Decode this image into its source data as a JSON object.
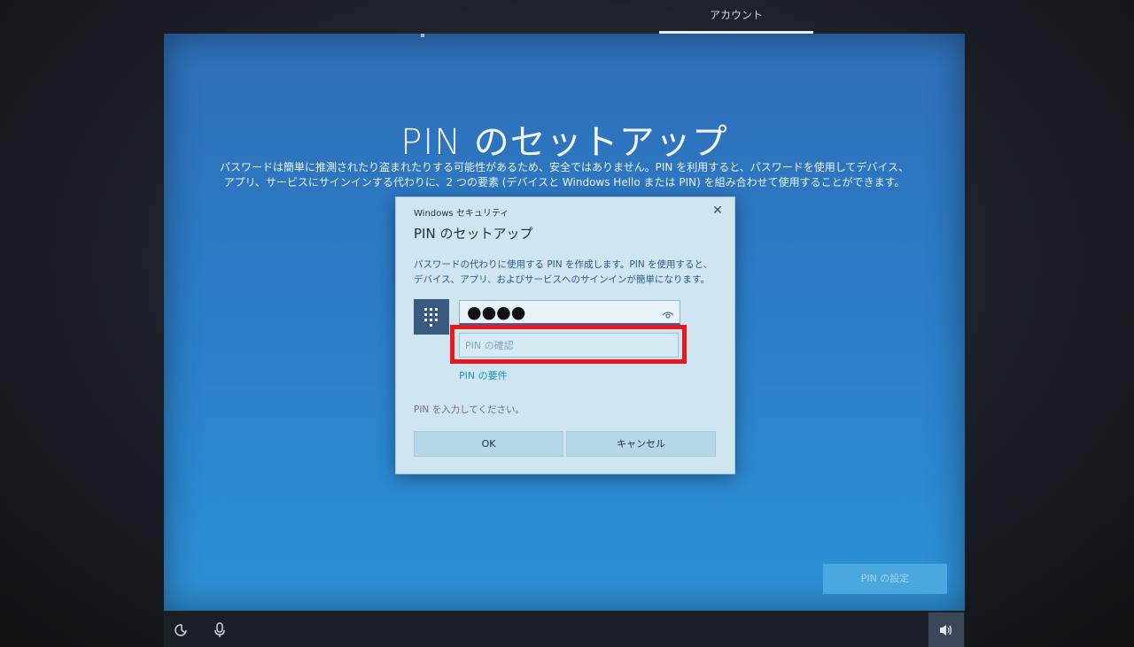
{
  "top_tabs": {
    "account": "アカウント"
  },
  "main": {
    "title": "PIN のセットアップ",
    "description": "パスワードは簡単に推測されたり盗まれたりする可能性があるため、安全ではありません。PIN を利用すると、パスワードを使用してデバイス、アプリ、サービスにサインインする代わりに、2 つの要素 (デバイスと Windows Hello または PIN) を組み合わせて使用することができます。",
    "set_pin_button": "PIN の設定"
  },
  "dialog": {
    "caption": "Windows セキュリティ",
    "close_glyph": "✕",
    "title": "PIN のセットアップ",
    "description": "パスワードの代わりに使用する PIN を作成します。PIN を使用すると、デバイス、アプリ、およびサービスへのサインインが簡単になります。",
    "pin_value": "●●●●",
    "confirm_placeholder": "PIN の確認",
    "pin_requirements_link": "PIN の要件",
    "status": "PIN を入力してください。",
    "ok_label": "OK",
    "cancel_label": "キャンセル"
  },
  "icons": [
    "keypad-icon",
    "eye-icon",
    "accessibility-icon",
    "microphone-icon",
    "volume-icon"
  ],
  "colors": {
    "highlight": "#e8191c",
    "screen_blue": "#2b7bc6",
    "dialog_bg": "#cfe6f1"
  }
}
